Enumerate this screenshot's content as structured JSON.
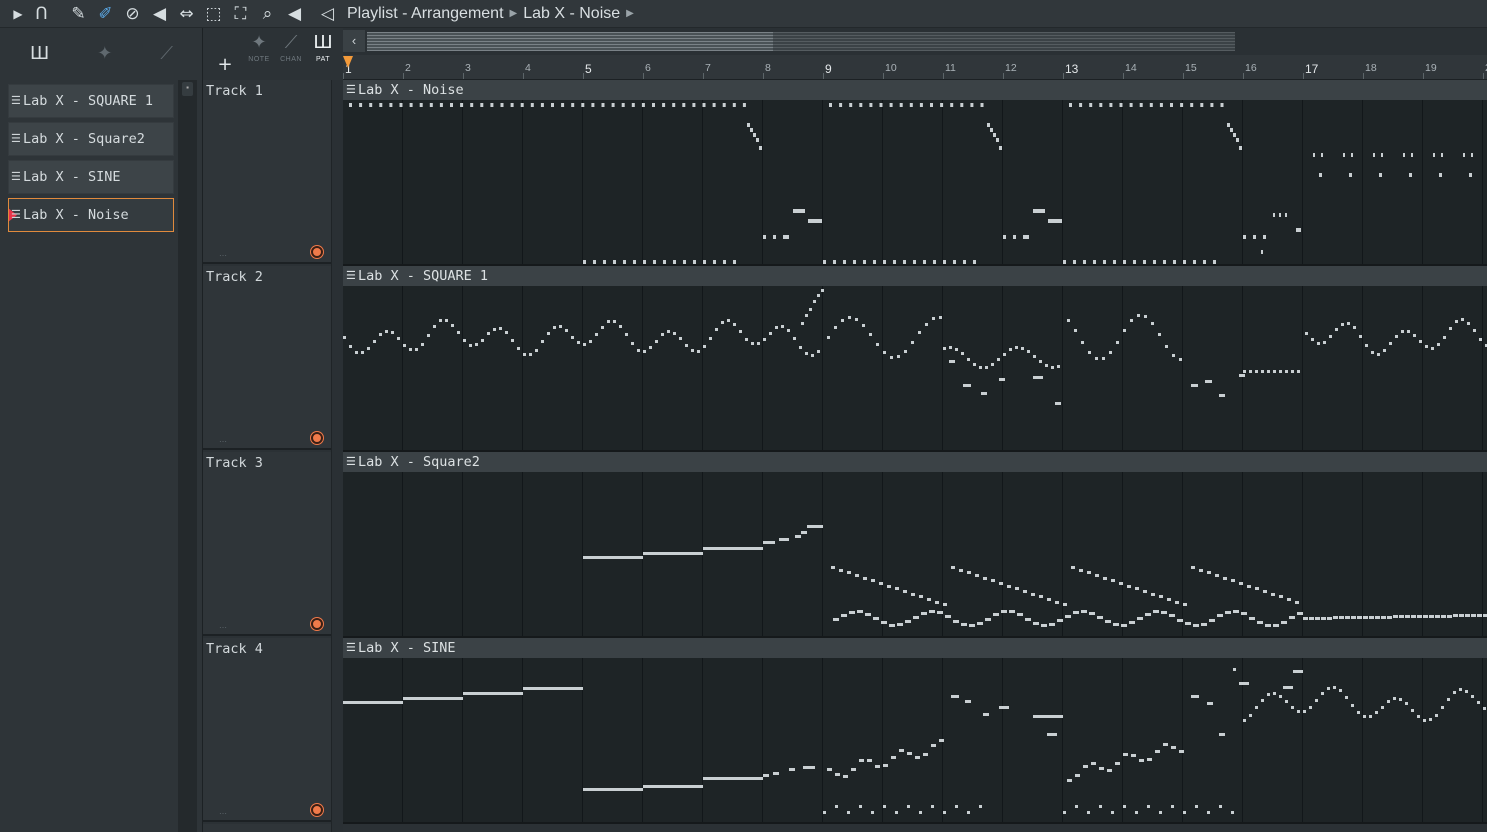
{
  "toolbar": {
    "icons": [
      "play-menu-icon",
      "magnet-icon",
      "draw-icon",
      "paint-icon",
      "delete-icon",
      "mute-icon",
      "slip-icon",
      "select-icon",
      "zoom-icon",
      "playback-icon",
      "speaker-icon"
    ]
  },
  "breadcrumb": {
    "window": "Playlist - Arrangement",
    "pattern": "Lab X - Noise"
  },
  "picker": {
    "items": [
      {
        "label": "Lab X - SQUARE 1",
        "selected": false
      },
      {
        "label": "Lab X - Square2",
        "selected": false
      },
      {
        "label": "Lab X - SINE",
        "selected": false
      },
      {
        "label": "Lab X - Noise",
        "selected": true
      }
    ]
  },
  "modes": {
    "add": "+",
    "note": "NOTE",
    "chan": "CHAN",
    "pat": "PAT"
  },
  "ruler": {
    "bars": [
      "1",
      "2",
      "3",
      "4",
      "5",
      "6",
      "7",
      "8",
      "9",
      "10",
      "11",
      "12",
      "13",
      "14",
      "15",
      "16",
      "17",
      "18",
      "19",
      "2"
    ],
    "major": [
      "1",
      "5",
      "9",
      "13",
      "17"
    ]
  },
  "tracks": [
    {
      "name": "Track 1",
      "clip": "Lab X - Noise"
    },
    {
      "name": "Track 2",
      "clip": "Lab X - SQUARE 1"
    },
    {
      "name": "Track 3",
      "clip": "Lab X - Square2"
    },
    {
      "name": "Track 4",
      "clip": "Lab X - SINE"
    }
  ],
  "colors": {
    "accent": "#e08a3d",
    "record": "#f07a4a",
    "note": "#c9cfd2",
    "selected_marker": "#e8344a"
  }
}
